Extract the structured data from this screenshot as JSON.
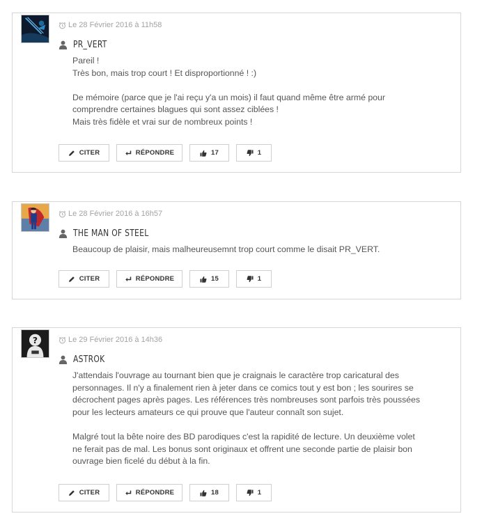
{
  "comments": [
    {
      "date": "Le 28 Février 2016 à 11h58",
      "author": "PR_VERT",
      "paragraphs": [
        "Pareil !\nTrès bon, mais trop court ! Et disproportionné ! :)",
        "De mémoire (parce que je l'ai reçu y'a un mois) il faut quand même être armé pour\ncomprendre certaines blagues qui sont assez ciblées !\nMais très fidèle et vrai sur de nombreux points !"
      ],
      "actions": {
        "cite": "CITER",
        "reply": "RÉPONDRE",
        "likes": "17",
        "dislikes": "1"
      }
    },
    {
      "date": "Le 28 Février 2016 à 16h57",
      "author": "THE MAN OF STEEL",
      "paragraphs": [
        "Beaucoup de plaisir, mais malheureusemnt trop court comme le disait PR_VERT."
      ],
      "actions": {
        "cite": "CITER",
        "reply": "RÉPONDRE",
        "likes": "15",
        "dislikes": "1"
      }
    },
    {
      "date": "Le 29 Février 2016 à 14h36",
      "author": "ASTROK",
      "paragraphs": [
        "J'attendais l'ouvrage au tournant bien que je craignais le caractère trop caricatural des\npersonnages. Il n'y a finalement rien à jeter dans ce comics tout y est bon ; les sourires se\ndécrochent pages après pages. Les références très nombreuses sont parfois très poussées\npour les lecteurs amateurs ce qui prouve que l'auteur connaît son sujet.",
        "Malgré tout la bête noire des BD parodiques c'est la rapidité de lecture. Un deuxième volet\nne ferait pas de mal. Les bonus sont originaux et offrent une seconde partie de plaisir bon\nouvrage bien ficelé du début à la fin."
      ],
      "actions": {
        "cite": "CITER",
        "reply": "RÉPONDRE",
        "likes": "18",
        "dislikes": "1"
      }
    }
  ],
  "colors": {
    "border": "#d6d6d6",
    "text": "#555555",
    "date": "#a3a3a3",
    "author": "#333333"
  },
  "icons": [
    "alarm-clock-icon",
    "user-icon",
    "pencil-icon",
    "reply-arrow-icon",
    "thumbs-up-icon",
    "thumbs-down-icon"
  ]
}
